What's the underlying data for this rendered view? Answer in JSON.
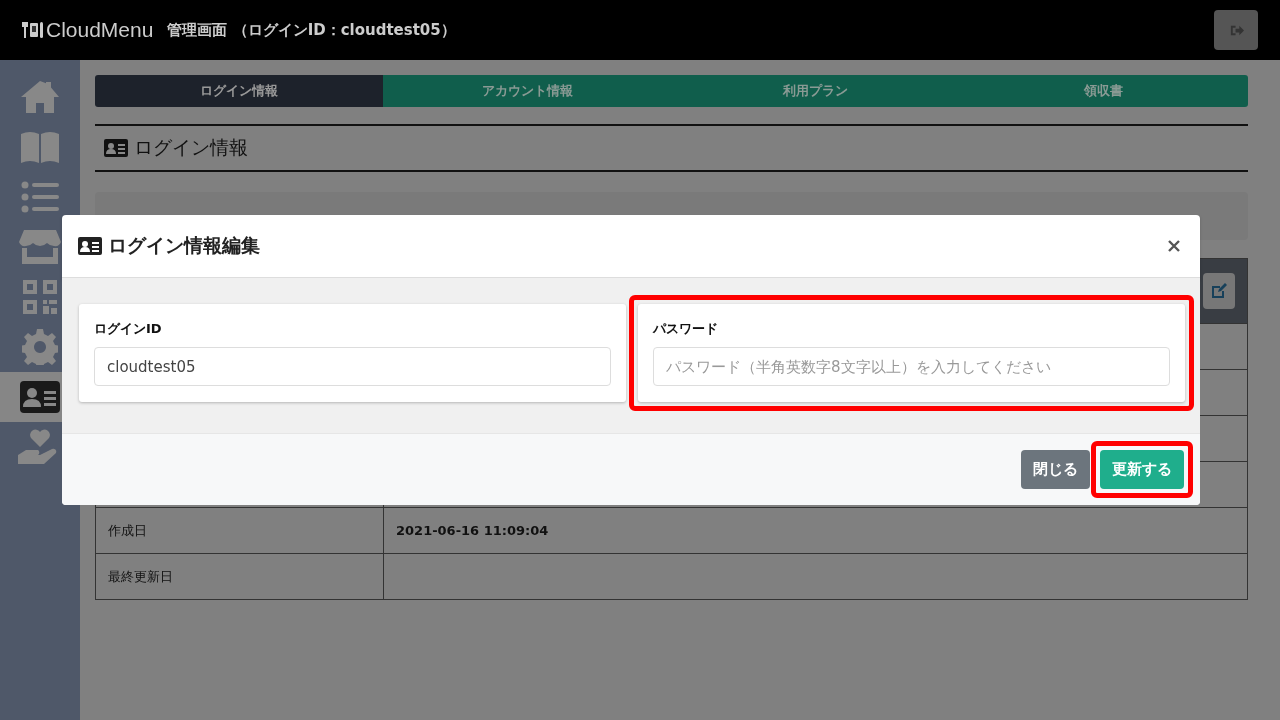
{
  "header": {
    "logo": "CloudMenu",
    "title": "管理画面 （ログインID：cloudtest05）"
  },
  "sidebar": {
    "items": [
      {
        "selected": false
      },
      {
        "selected": false
      },
      {
        "selected": false
      },
      {
        "selected": false
      },
      {
        "selected": false
      },
      {
        "selected": false
      },
      {
        "selected": true
      },
      {
        "selected": false
      }
    ]
  },
  "tabs": [
    {
      "label": "ログイン情報",
      "selected": true
    },
    {
      "label": "アカウント情報",
      "selected": false
    },
    {
      "label": "利用プラン",
      "selected": false
    },
    {
      "label": "領収書",
      "selected": false
    }
  ],
  "section_title": "ログイン情報",
  "table": {
    "rows": [
      {
        "label": "作成日",
        "value": "2021-06-16 11:09:04"
      },
      {
        "label": "最終更新日"
      }
    ]
  },
  "modal": {
    "title": "ログイン情報編集",
    "fields": [
      {
        "label": "ログインID",
        "value": "cloudtest05",
        "highlighted": false
      },
      {
        "label": "パスワード",
        "placeholder": "パスワード（半角英数字8文字以上）を入力してください",
        "highlighted": true
      }
    ],
    "buttons": [
      {
        "label": "閉じる",
        "kind": "secondary",
        "highlighted": false
      },
      {
        "label": "更新する",
        "kind": "primary",
        "highlighted": true
      }
    ]
  }
}
